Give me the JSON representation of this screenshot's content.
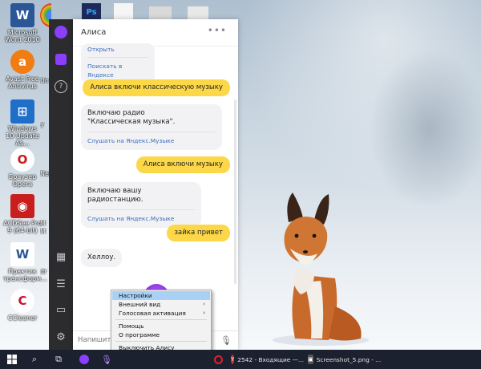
{
  "desktop": {
    "icons": [
      {
        "label": "Microsoft Word 2010",
        "glyph": "W",
        "color": "#2b5797"
      },
      {
        "label": "Avast Free Antivirus",
        "glyph": "a",
        "color": "#f07c12"
      },
      {
        "label": "Windows 10 Update As...",
        "glyph": "⊞",
        "color": "#1f6fc9"
      },
      {
        "label": "Браузер Opera",
        "glyph": "O",
        "color": "#cc1a1a"
      },
      {
        "label": "ACDSee Pro 9 (64-bit)",
        "glyph": "◉",
        "color": "#c81e1e"
      },
      {
        "label": "Практик трансформ...",
        "glyph": "W",
        "color": "#2b5797"
      },
      {
        "label": "CCleaner",
        "glyph": "C",
        "color": "#c8102e"
      }
    ],
    "partial_labels": [
      "Un",
      "Y",
      "Nero",
      "M",
      "M",
      "dr"
    ]
  },
  "alice": {
    "title": "Алиса",
    "more": "•••",
    "messages": [
      {
        "side": "left",
        "text": "Открыть",
        "link": "Поискать в Яндексе"
      },
      {
        "side": "right",
        "text": "Алиса включи классическую музыку"
      },
      {
        "side": "left",
        "text": "Включаю радио \"Классическая музыка\".",
        "link": "Слушать на Яндекс.Музыке"
      },
      {
        "side": "right",
        "text": "Алиса включи музыку"
      },
      {
        "side": "left",
        "text": "Включаю вашу радиостанцию.",
        "link": "Слушать на Яндекс.Музыке"
      },
      {
        "side": "right",
        "text": "зайка привет"
      },
      {
        "side": "left",
        "text": "Хеллоу."
      }
    ],
    "input_placeholder": "Напишите",
    "sidebar_icons": [
      "alice-logo-icon",
      "store-icon",
      "help-icon",
      "skills-icon",
      "menu-icon",
      "folder-icon",
      "settings-icon"
    ],
    "help_glyph": "?"
  },
  "context_menu": {
    "items": [
      {
        "label": "Настройки",
        "highlighted": true,
        "submenu": false
      },
      {
        "label": "Внешний вид",
        "submenu": true
      },
      {
        "label": "Голосовая активация",
        "submenu": true
      },
      {
        "label": "Помощь",
        "submenu": false
      },
      {
        "label": "О программе",
        "submenu": false
      },
      {
        "label": "Выключить Алису",
        "submenu": false
      }
    ]
  },
  "taskbar": {
    "tasks": [
      {
        "label": "2542 - Входящие —...",
        "glyph": "Y",
        "color": "#d32f2f"
      },
      {
        "label": "Screenshot_5.png - ...",
        "glyph": "▣",
        "color": "#555"
      }
    ]
  }
}
